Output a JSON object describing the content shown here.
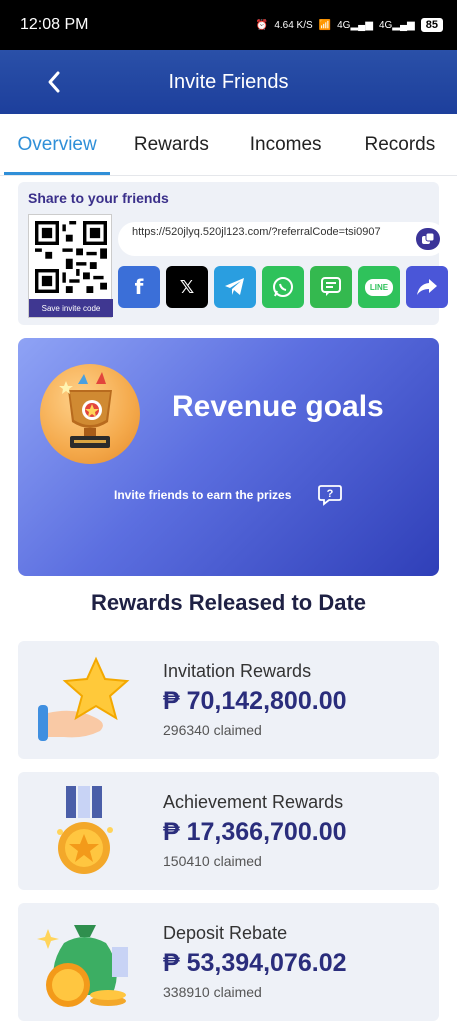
{
  "status_bar": {
    "time": "12:08 PM",
    "network_speed": "4.64 K/S",
    "battery": "85"
  },
  "header": {
    "title": "Invite Friends"
  },
  "tabs": [
    {
      "label": "Overview",
      "active": true
    },
    {
      "label": "Rewards",
      "active": false
    },
    {
      "label": "Incomes",
      "active": false
    },
    {
      "label": "Records",
      "active": false
    }
  ],
  "share": {
    "title": "Share to your friends",
    "save_invite_code": "Save invite code",
    "link": "https://520jlyq.520jl123.com/?referralCode=tsi0907",
    "social_icons": [
      "facebook-icon",
      "x-icon",
      "telegram-icon",
      "whatsapp-icon",
      "sms-icon",
      "line-icon",
      "share-icon"
    ]
  },
  "revenue": {
    "title": "Revenue goals",
    "subtitle": "Invite friends to earn the prizes"
  },
  "rewards_section": {
    "title": "Rewards Released to Date",
    "items": [
      {
        "label": "Invitation Rewards",
        "amount": "₱ 70,142,800.00",
        "claimed": "296340 claimed",
        "icon": "star-hand-icon"
      },
      {
        "label": "Achievement Rewards",
        "amount": "₱ 17,366,700.00",
        "claimed": "150410 claimed",
        "icon": "medal-icon"
      },
      {
        "label": "Deposit Rebate",
        "amount": "₱ 53,394,076.02",
        "claimed": "338910 claimed",
        "icon": "money-bag-icon"
      }
    ]
  },
  "colors": {
    "header_bg": "#1d3f9c",
    "tab_active": "#2f8fd8",
    "amount_text": "#2a2d7c"
  }
}
